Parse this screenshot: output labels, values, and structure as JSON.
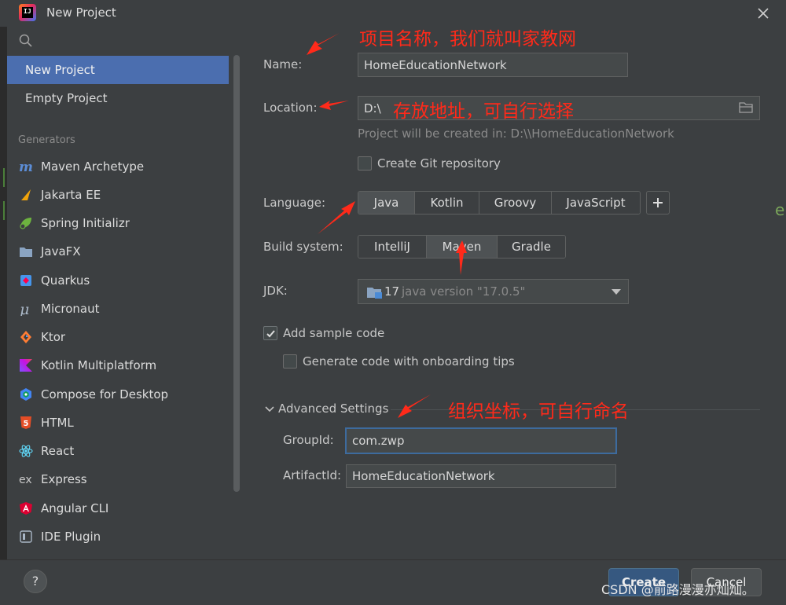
{
  "window": {
    "title": "New Project",
    "logo_text": "IJ"
  },
  "sidebar": {
    "top_items": [
      {
        "label": "New Project",
        "selected": true
      },
      {
        "label": "Empty Project",
        "selected": false
      }
    ],
    "section_label": "Generators",
    "generators": [
      {
        "label": "Maven Archetype",
        "icon": "maven-icon"
      },
      {
        "label": "Jakarta EE",
        "icon": "jakarta-ee-icon"
      },
      {
        "label": "Spring Initializr",
        "icon": "spring-icon"
      },
      {
        "label": "JavaFX",
        "icon": "javafx-icon"
      },
      {
        "label": "Quarkus",
        "icon": "quarkus-icon"
      },
      {
        "label": "Micronaut",
        "icon": "micronaut-icon"
      },
      {
        "label": "Ktor",
        "icon": "ktor-icon"
      },
      {
        "label": "Kotlin Multiplatform",
        "icon": "kotlin-icon"
      },
      {
        "label": "Compose for Desktop",
        "icon": "compose-icon"
      },
      {
        "label": "HTML",
        "icon": "html5-icon"
      },
      {
        "label": "React",
        "icon": "react-icon"
      },
      {
        "label": "Express",
        "icon": "express-icon"
      },
      {
        "label": "Angular CLI",
        "icon": "angular-icon"
      },
      {
        "label": "IDE Plugin",
        "icon": "ide-plugin-icon"
      }
    ]
  },
  "form": {
    "name_label": "Name:",
    "name_value": "HomeEducationNetwork",
    "location_label": "Location:",
    "location_value": "D:\\",
    "location_hint": "Project will be created in: D:\\\\HomeEducationNetwork",
    "git_label": "Create Git repository",
    "git_checked": false,
    "language_label": "Language:",
    "languages": [
      "Java",
      "Kotlin",
      "Groovy",
      "JavaScript"
    ],
    "language_selected": "Java",
    "add_language": "+",
    "build_label": "Build system:",
    "build_systems": [
      "IntelliJ",
      "Maven",
      "Gradle"
    ],
    "build_selected": "Maven",
    "jdk_label": "JDK:",
    "jdk_version": "17",
    "jdk_detail": "java version \"17.0.5\"",
    "sample_label": "Add sample code",
    "sample_checked": true,
    "onboarding_label": "Generate code with onboarding tips",
    "onboarding_checked": false,
    "advanced_label": "Advanced Settings",
    "groupid_label": "GroupId:",
    "groupid_value": "com.zwp",
    "artifactid_label": "ArtifactId:",
    "artifactid_value": "HomeEducationNetwork"
  },
  "buttons": {
    "help": "?",
    "create": "Create",
    "cancel": "Cancel"
  },
  "annotations": {
    "name_note": "项目名称，我们就叫家教网",
    "location_note": "存放地址，可自行选择",
    "group_note": "组织坐标，可自行命名",
    "color": "#ff2a1a"
  },
  "watermark": "CSDN @前路漫漫亦灿灿。",
  "edge_glyph": "e",
  "colors": {
    "accent": "#4b6eaf",
    "panel": "#3c3f41",
    "primary_button": "#365880"
  }
}
